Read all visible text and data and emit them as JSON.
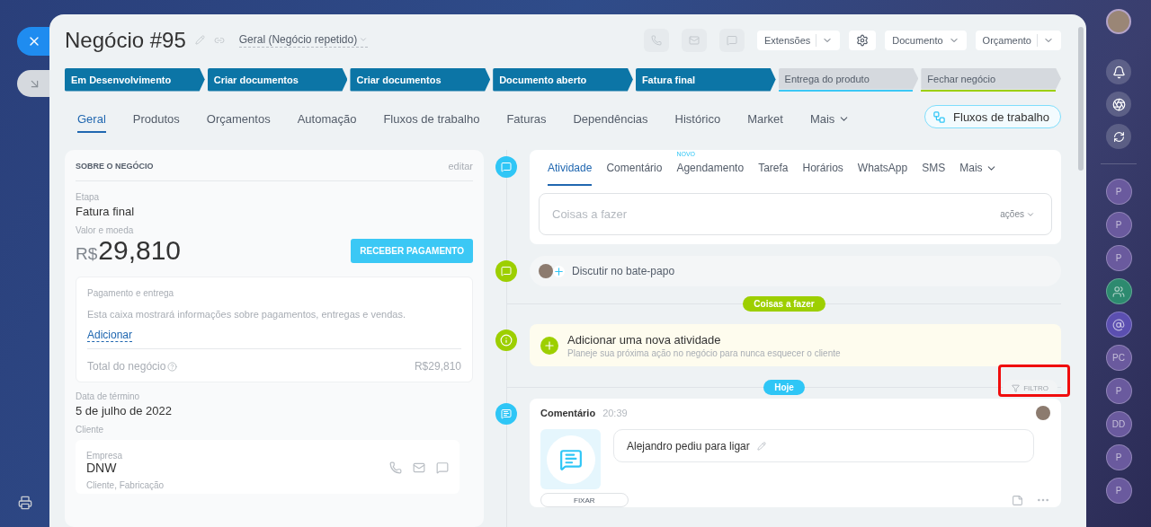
{
  "deal": {
    "title": "Negócio #95",
    "pipeline": "Geral (Negócio repetido)"
  },
  "toolbar": [
    {
      "kind": "split",
      "label": "Extensões"
    },
    {
      "kind": "settings"
    },
    {
      "kind": "dropdown",
      "label": "Documento"
    },
    {
      "kind": "split",
      "label": "Orçamento"
    }
  ],
  "stages": [
    {
      "label": "Em Desenvolvimento",
      "passed": true
    },
    {
      "label": "Criar documentos",
      "passed": true
    },
    {
      "label": "Criar documentos",
      "passed": true
    },
    {
      "label": "Documento aberto",
      "passed": true
    },
    {
      "label": "Fatura final",
      "passed": true
    },
    {
      "label": "Entrega do produto",
      "passed": false,
      "color": "#3bc8f5"
    },
    {
      "label": "Fechar negócio",
      "passed": false,
      "color": "#9dcf00"
    }
  ],
  "tabs": [
    {
      "label": "Geral",
      "selected": true
    },
    {
      "label": "Produtos",
      "selected": false
    },
    {
      "label": "Orçamentos",
      "selected": false
    },
    {
      "label": "Automação",
      "selected": false
    },
    {
      "label": "Fluxos de trabalho",
      "selected": false
    },
    {
      "label": "Faturas",
      "selected": false
    },
    {
      "label": "Dependências",
      "selected": false
    },
    {
      "label": "Histórico",
      "selected": false
    },
    {
      "label": "Market",
      "selected": false
    },
    {
      "label": "Mais",
      "selected": false,
      "kind": "menu"
    }
  ],
  "workflow_button": "Fluxos de trabalho",
  "about": {
    "heading": "SOBRE O NEGÓCIO",
    "edit": "editar",
    "stage_label": "Etapa",
    "stage": "Fatura final",
    "amount_label": "Valor e moeda",
    "currency": "R$",
    "amount": "29,810",
    "pay_button": "RECEBER PAGAMENTO",
    "payment": {
      "title": "Pagamento e entrega",
      "text": "Esta caixa mostrará informações sobre pagamentos, entregas e vendas.",
      "add_link": "Adicionar",
      "total_label": "Total do negócio",
      "total": "R$29,810"
    },
    "end_date_label": "Data de término",
    "end_date": "5 de julho de 2022",
    "client_label": "Cliente",
    "company_label": "Empresa",
    "company": "DNW",
    "client_type": "Cliente, Fabricação"
  },
  "activity_tabs": [
    {
      "label": "Atividade",
      "selected": true
    },
    {
      "label": "Comentário",
      "selected": false
    },
    {
      "label": "Agendamento",
      "selected": false,
      "badge": "NOVO"
    },
    {
      "label": "Tarefa",
      "selected": false
    },
    {
      "label": "Horários",
      "selected": false
    },
    {
      "label": "WhatsApp",
      "selected": false
    },
    {
      "label": "SMS",
      "selected": false
    },
    {
      "label": "Mais",
      "selected": false,
      "kind": "menu"
    }
  ],
  "todo_field": {
    "placeholder": "Coisas a fazer",
    "actions": "ações"
  },
  "chat": "Discutir no bate-papo",
  "todo_pill": "Coisas a fazer",
  "new_activity": {
    "title": "Adicionar uma nova atividade",
    "subtitle": "Planeje sua próxima ação no negócio para nunca esquecer o cliente"
  },
  "today_pill": "Hoje",
  "filter": "FILTRO",
  "comment": {
    "title": "Comentário",
    "time": "20:39",
    "text": "Alejandro pediu para ligar",
    "pin": "FIXAR"
  },
  "contacts": [
    {
      "kind": "letter",
      "initials": "P"
    },
    {
      "kind": "letter",
      "initials": "P"
    },
    {
      "kind": "letter",
      "initials": "P"
    },
    {
      "kind": "group"
    },
    {
      "kind": "mention"
    },
    {
      "kind": "letter",
      "initials": "PC"
    },
    {
      "kind": "letter",
      "initials": "P"
    },
    {
      "kind": "letter",
      "initials": "DD"
    },
    {
      "kind": "letter",
      "initials": "P"
    },
    {
      "kind": "letter",
      "initials": "P"
    }
  ]
}
